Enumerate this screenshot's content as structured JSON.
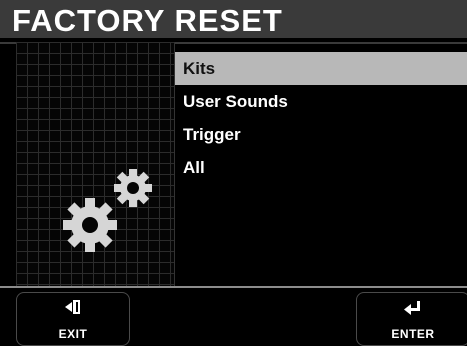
{
  "header": {
    "title": "FACTORY RESET"
  },
  "menu": {
    "items": [
      {
        "label": "Kits",
        "selected": true
      },
      {
        "label": "User Sounds",
        "selected": false
      },
      {
        "label": "Trigger",
        "selected": false
      },
      {
        "label": "All",
        "selected": false
      }
    ]
  },
  "footer": {
    "exit_label": "EXIT",
    "exit_icon": "exit-icon",
    "enter_label": "ENTER",
    "enter_icon": "enter-return-icon"
  },
  "colors": {
    "header_bg": "#3a3a3a",
    "selected_bg": "#b8b8b8",
    "gear": "#d6d6d6"
  }
}
